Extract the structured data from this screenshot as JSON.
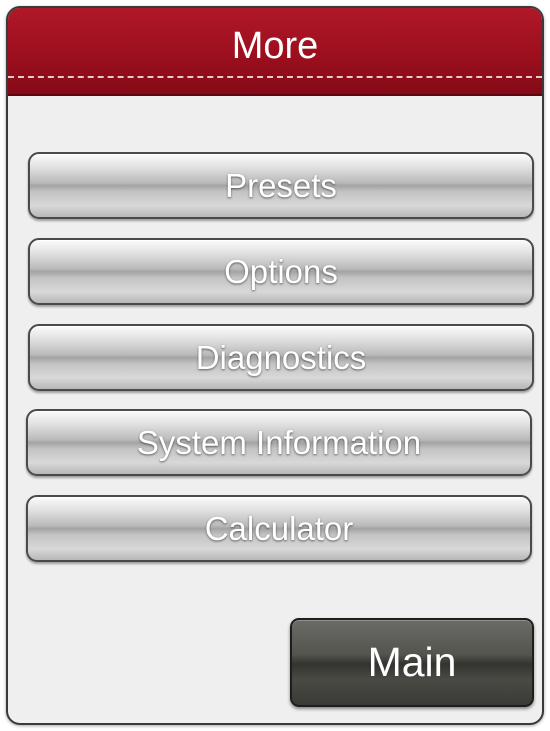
{
  "header": {
    "title": "More"
  },
  "menu": {
    "items": [
      {
        "label": "Presets"
      },
      {
        "label": "Options"
      },
      {
        "label": "Diagnostics"
      },
      {
        "label": "System Information"
      },
      {
        "label": "Calculator"
      }
    ]
  },
  "footer": {
    "main_label": "Main"
  },
  "colors": {
    "header_red": "#9c0f1e",
    "panel_background": "#efefef",
    "button_silver": "#b9b9b9",
    "main_button_dark": "#4a4a45"
  }
}
